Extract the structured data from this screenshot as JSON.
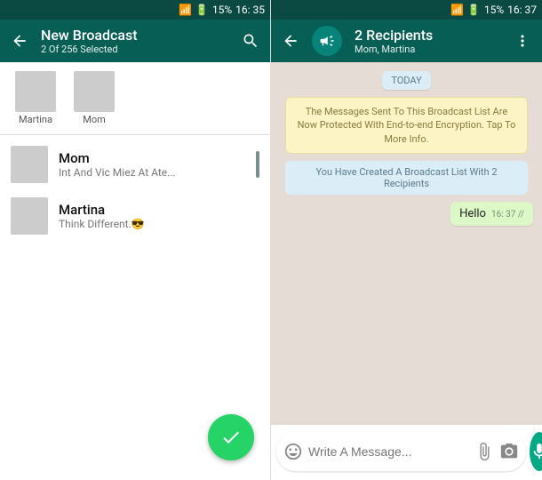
{
  "left": {
    "statusbar": {
      "battery": "15%",
      "time": "16: 35"
    },
    "header": {
      "title": "New Broadcast",
      "subtitle": "2 Of 256 Selected"
    },
    "selected": [
      {
        "name": "Martina"
      },
      {
        "name": "Mom"
      }
    ],
    "contacts": [
      {
        "name": "Mom",
        "status": "Int And Vic Miez At Ate..."
      },
      {
        "name": "Martina",
        "status": "Think Different.😎"
      }
    ]
  },
  "right": {
    "statusbar": {
      "battery": "15%",
      "time": "16: 37"
    },
    "header": {
      "title": "2 Recipients",
      "subtitle": "Mom, Martina"
    },
    "date_chip": "TODAY",
    "encryption_notice": "The Messages Sent To This Broadcast List Are Now Protected With End-to-end Encryption. Tap To More Info.",
    "created_notice": "You Have Created A Broadcast List With 2 Recipients",
    "message": {
      "text": "Hello",
      "time": "16: 37 //"
    },
    "composer": {
      "placeholder": "Write A Message..."
    }
  }
}
